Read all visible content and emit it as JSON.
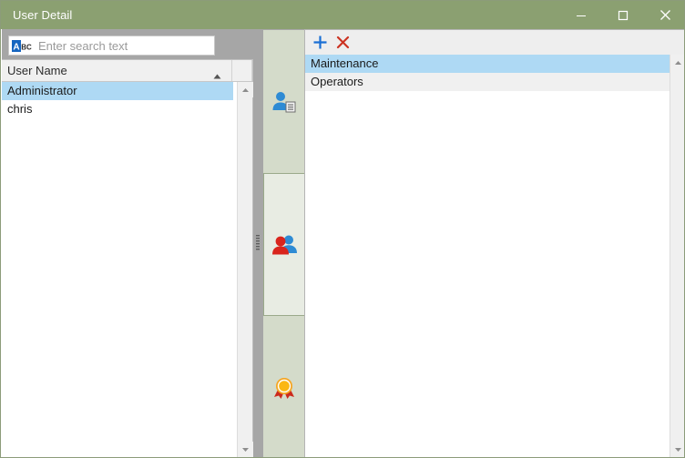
{
  "window": {
    "title": "User Detail",
    "titlebar_color": "#8ba071",
    "controls": [
      {
        "name": "minimize-button",
        "glyph": "minimize"
      },
      {
        "name": "maximize-button",
        "glyph": "maximize"
      },
      {
        "name": "close-button",
        "glyph": "close"
      }
    ]
  },
  "left_panel": {
    "search": {
      "placeholder": "Enter search text",
      "value": "",
      "icon": "abc-icon"
    },
    "grid": {
      "columns": [
        {
          "label": "User Name",
          "sort": "ascending"
        },
        {
          "label": ""
        }
      ],
      "rows": [
        {
          "user_name": "Administrator",
          "selected": true
        },
        {
          "user_name": "chris",
          "selected": false
        }
      ]
    },
    "scrollbar": {
      "up_arrow": "scroll-up-arrow-icon",
      "down_arrow": "scroll-down-arrow-icon"
    }
  },
  "splitter": {
    "name": "pane-splitter",
    "grip": "splitter-grip-icon"
  },
  "tabstrip": {
    "tabs": [
      {
        "name": "tab-user-details",
        "icon": "user-card-icon",
        "selected": false
      },
      {
        "name": "tab-user-groups",
        "icon": "users-group-icon",
        "selected": true
      },
      {
        "name": "tab-user-permissions",
        "icon": "award-rosette-icon",
        "selected": false
      }
    ]
  },
  "right_panel": {
    "toolbar": {
      "add_label": "+",
      "delete_label": "×",
      "add_name": "add-button",
      "delete_name": "delete-button",
      "add_color": "#1a6fd4",
      "delete_color": "#cc3322"
    },
    "list": {
      "items": [
        {
          "label": "Maintenance",
          "selected": true
        },
        {
          "label": "Operators",
          "selected": false
        }
      ]
    },
    "scrollbar": {
      "up_arrow": "scroll-up-arrow-icon",
      "down_arrow": "scroll-down-arrow-icon"
    }
  },
  "colors": {
    "accent_green": "#8ba071",
    "tab_inactive": "#d4dbca",
    "tab_active": "#e8ece3",
    "selection_blue": "#aed9f4",
    "pane_background": "#a6a6a6"
  }
}
